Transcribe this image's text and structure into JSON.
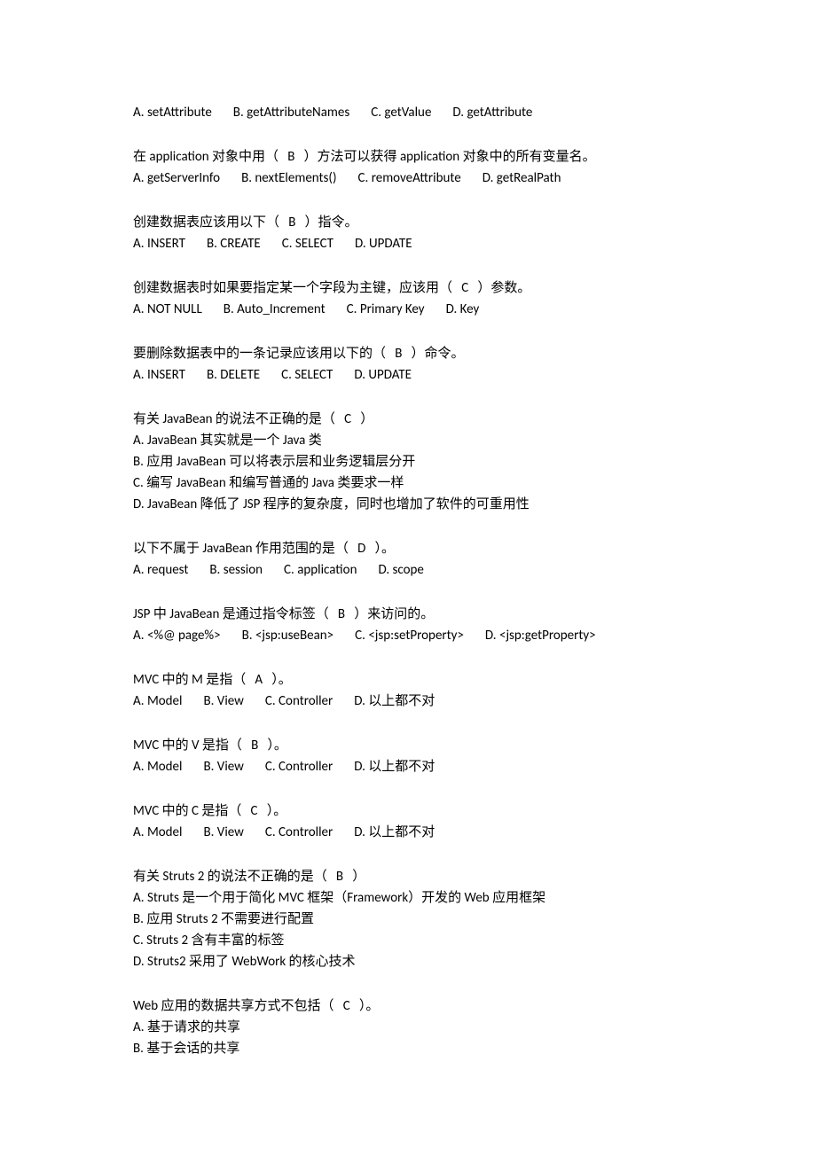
{
  "blocks": [
    {
      "type": "options_only",
      "options": [
        "A. setAttribute",
        "B. getAttributeNames",
        "C. getValue",
        "D. getAttribute"
      ]
    },
    {
      "type": "qa",
      "q_pre": "在 application 对象中用（",
      "q_ans": "B",
      "q_post": "）方法可以获得 application 对象中的所有变量名。",
      "options": [
        "A. getServerInfo",
        "B. nextElements()",
        "C. removeAttribute",
        "D. getRealPath"
      ]
    },
    {
      "type": "qa",
      "q_pre": "创建数据表应该用以下（",
      "q_ans": "B",
      "q_post": "）指令。",
      "options": [
        "A. INSERT",
        "B. CREATE",
        "C. SELECT",
        "D. UPDATE"
      ]
    },
    {
      "type": "qa",
      "q_pre": "创建数据表时如果要指定某一个字段为主键，应该用（",
      "q_ans": "C",
      "q_post": "）参数。",
      "options": [
        "A. NOT NULL",
        "B. Auto_Increment",
        "C. Primary Key",
        "D. Key"
      ]
    },
    {
      "type": "qa",
      "q_pre": "要删除数据表中的一条记录应该用以下的（",
      "q_ans": "B",
      "q_post": "）命令。",
      "options": [
        "A. INSERT",
        "B. DELETE",
        "C. SELECT",
        "D. UPDATE"
      ]
    },
    {
      "type": "qa_multiline",
      "q_pre": "有关 JavaBean 的说法不正确的是（",
      "q_ans": "C",
      "q_post": "）",
      "options_lines": [
        "A. JavaBean 其实就是一个 Java 类",
        "B.  应用 JavaBean 可以将表示层和业务逻辑层分开",
        "C.  编写 JavaBean 和编写普通的 Java 类要求一样",
        "D. JavaBean 降低了 JSP 程序的复杂度，同时也增加了软件的可重用性"
      ]
    },
    {
      "type": "qa",
      "q_pre": "以下不属于 JavaBean 作用范围的是（",
      "q_ans": "D",
      "q_post": "）。",
      "options": [
        "A. request",
        "B. session",
        "C. application",
        "D. scope"
      ]
    },
    {
      "type": "qa",
      "q_pre": "JSP 中 JavaBean 是通过指令标签（",
      "q_ans": "B",
      "q_post": "）来访问的。",
      "options": [
        "A. <%@ page%>",
        "B. <jsp:useBean>",
        "C. <jsp:setProperty>",
        "D. <jsp:getProperty>"
      ]
    },
    {
      "type": "qa",
      "q_pre": "MVC 中的 M 是指（",
      "q_ans": "A",
      "q_post": "）。",
      "options": [
        "A. Model",
        "B. View",
        "C. Controller",
        "D.  以上都不对"
      ]
    },
    {
      "type": "qa",
      "q_pre": "MVC 中的 V 是指（",
      "q_ans": "B",
      "q_post": "）。",
      "options": [
        "A. Model",
        "B. View",
        "C. Controller",
        "D.  以上都不对"
      ]
    },
    {
      "type": "qa",
      "q_pre": "MVC 中的 C 是指（",
      "q_ans": "C",
      "q_post": "）。",
      "options": [
        "A. Model",
        "B. View",
        "C. Controller",
        "D.  以上都不对"
      ]
    },
    {
      "type": "qa_multiline",
      "q_pre": "有关 Struts 2 的说法不正确的是（",
      "q_ans": "B",
      "q_post": "）",
      "options_lines": [
        "A. Struts 是一个用于简化 MVC 框架（Framework）开发的 Web 应用框架",
        "B.  应用 Struts 2 不需要进行配置",
        "C. Struts 2  含有丰富的标签",
        "D. Struts2 采用了 WebWork 的核心技术"
      ]
    },
    {
      "type": "qa_multiline_partial",
      "q_pre": "Web 应用的数据共享方式不包括（",
      "q_ans": "C",
      "q_post": "）。",
      "options_lines": [
        "A.  基于请求的共享",
        "B.  基于会话的共享"
      ]
    }
  ]
}
